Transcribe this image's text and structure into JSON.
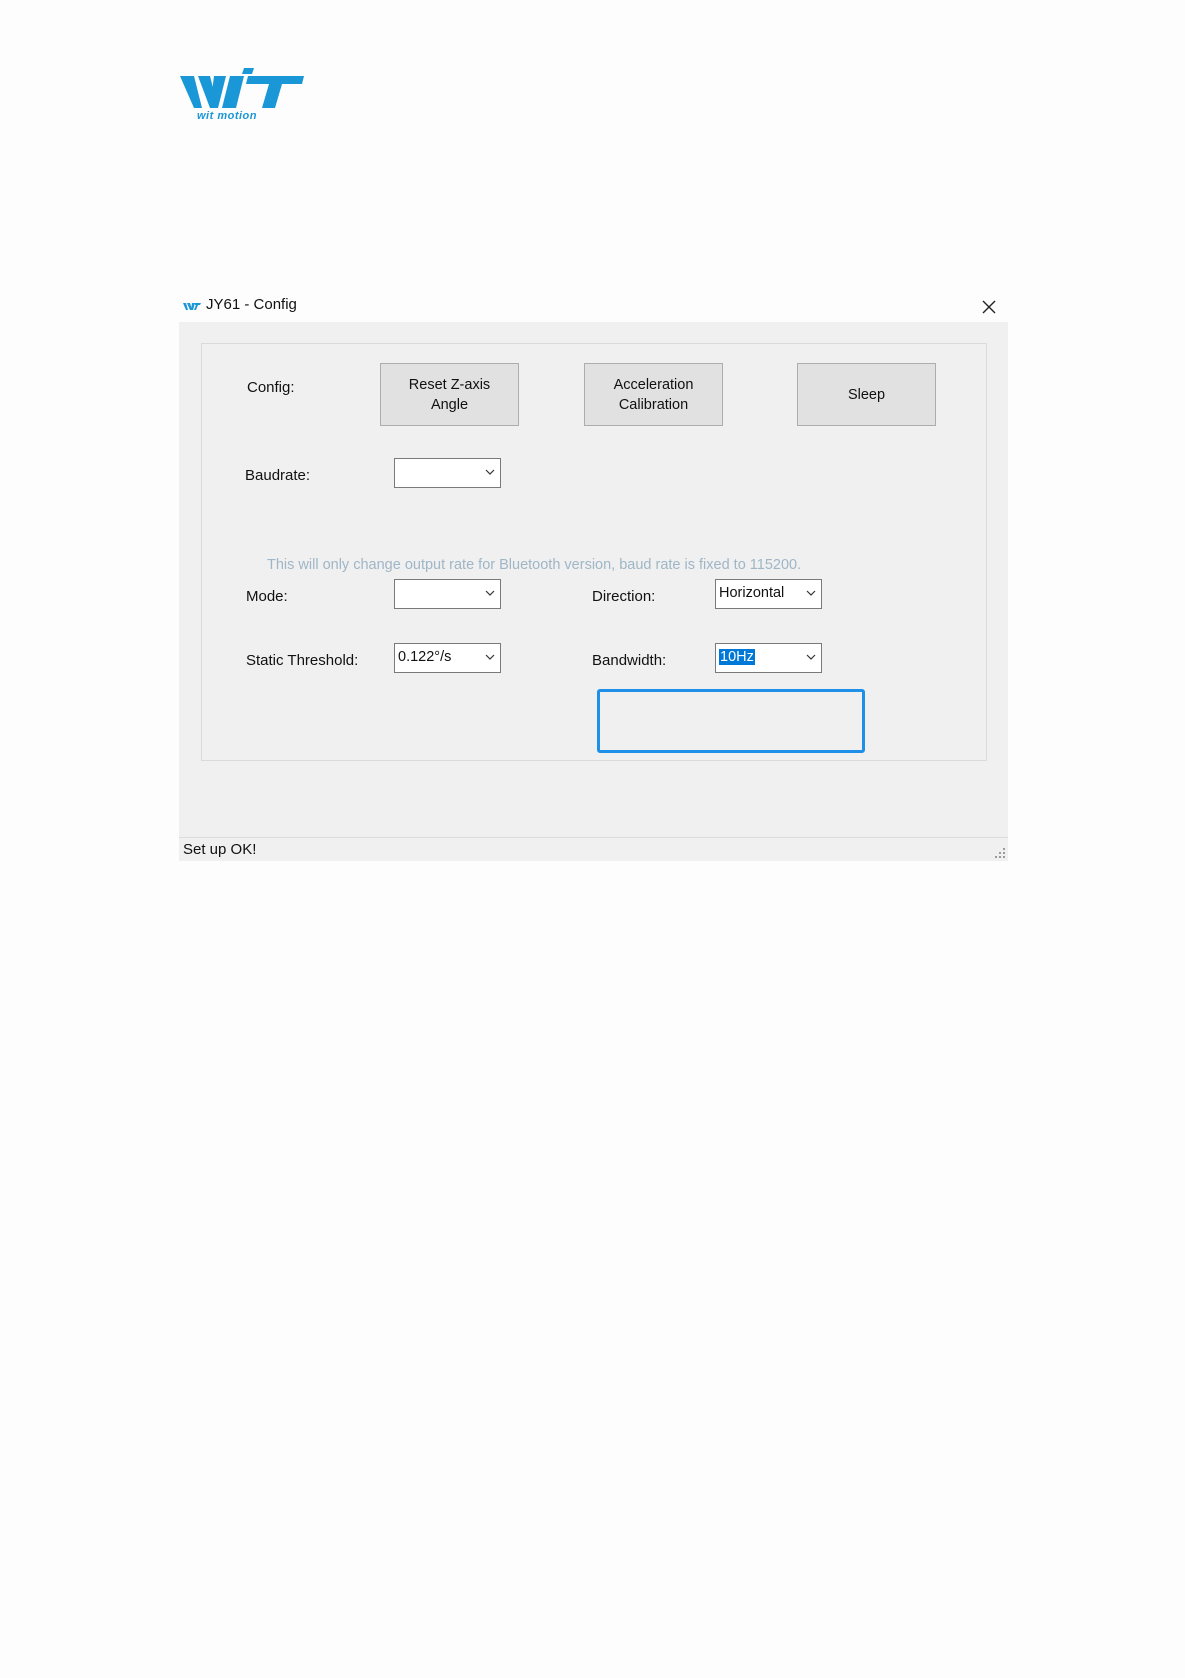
{
  "brand": {
    "logo_text": "wit motion",
    "logo_icon": "witmotion-logo"
  },
  "window": {
    "title": "JY61 - Config",
    "title_icon": "witmotion-small-logo-icon",
    "close_icon": "close-icon"
  },
  "config": {
    "label": "Config:",
    "buttons": {
      "reset_z_line1": "Reset Z-axis",
      "reset_z_line2": "Angle",
      "accel_line1": "Acceleration",
      "accel_line2": "Calibration",
      "sleep": "Sleep"
    }
  },
  "baudrate": {
    "label": "Baudrate:",
    "value": "",
    "hint": "This will only change output rate for Bluetooth version, baud rate is fixed to 115200."
  },
  "mode": {
    "label": "Mode:",
    "value": ""
  },
  "direction": {
    "label": "Direction:",
    "value": "Horizontal"
  },
  "static_threshold": {
    "label": "Static Threshold:",
    "value": "0.122°/s"
  },
  "bandwidth": {
    "label": "Bandwidth:",
    "value": "10Hz"
  },
  "status": {
    "text": "Set up OK!"
  },
  "colors": {
    "accent": "#1e90e8",
    "logo": "#1a97d6",
    "selection": "#0078d7",
    "hint": "#9fb6c6"
  }
}
